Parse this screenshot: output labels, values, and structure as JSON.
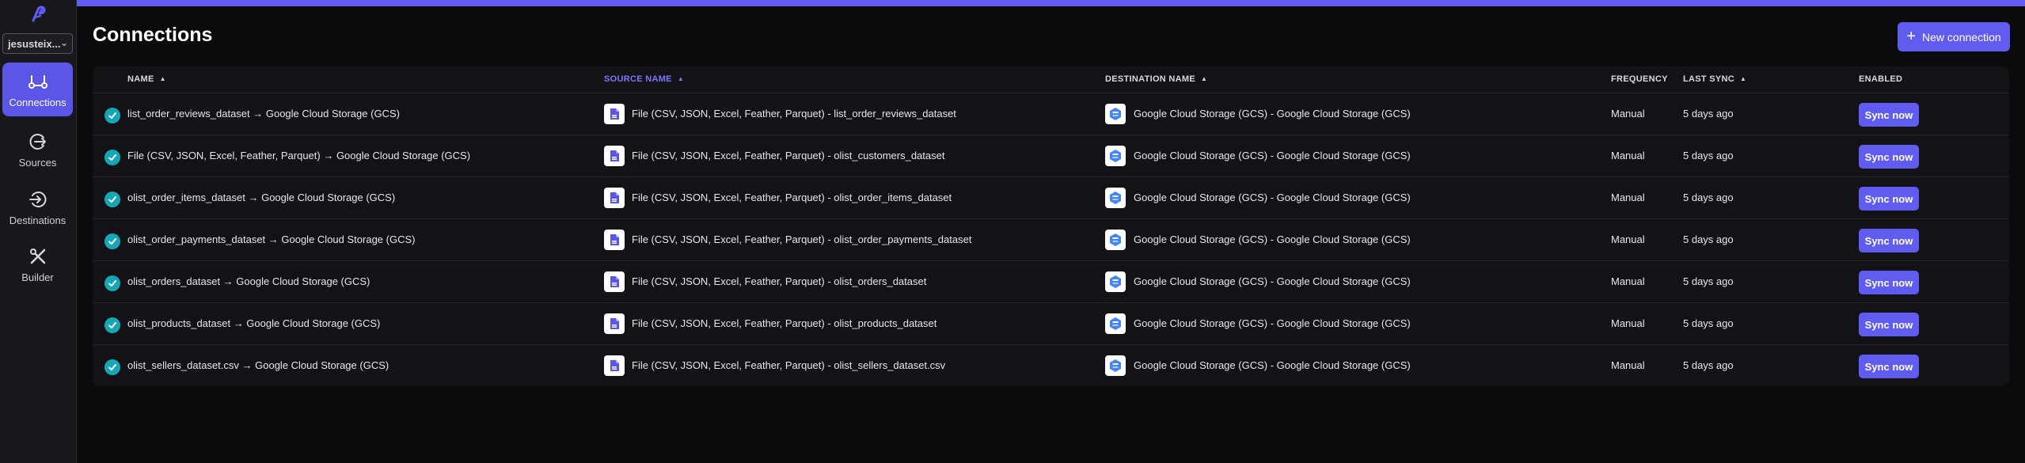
{
  "sidebar": {
    "workspace": "jesusteix...",
    "items": [
      {
        "label": "Connections",
        "icon": "connections-icon",
        "active": true
      },
      {
        "label": "Sources",
        "icon": "sources-icon",
        "active": false
      },
      {
        "label": "Destinations",
        "icon": "destinations-icon",
        "active": false
      },
      {
        "label": "Builder",
        "icon": "builder-icon",
        "active": false
      }
    ]
  },
  "header": {
    "title": "Connections",
    "new_button_label": "New connection"
  },
  "table": {
    "columns": {
      "name": "NAME",
      "source": "SOURCE NAME",
      "destination": "DESTINATION NAME",
      "frequency": "FREQUENCY",
      "last_sync": "LAST SYNC",
      "enabled": "ENABLED"
    },
    "sync_label": "Sync now",
    "rows": [
      {
        "name": "list_order_reviews_dataset → Google Cloud Storage (GCS)",
        "source": "File (CSV, JSON, Excel, Feather, Parquet) - list_order_reviews_dataset",
        "destination": "Google Cloud Storage (GCS) - Google Cloud Storage (GCS)",
        "frequency": "Manual",
        "last_sync": "5 days ago"
      },
      {
        "name": "File (CSV, JSON, Excel, Feather, Parquet) → Google Cloud Storage (GCS)",
        "source": "File (CSV, JSON, Excel, Feather, Parquet) - olist_customers_dataset",
        "destination": "Google Cloud Storage (GCS) - Google Cloud Storage (GCS)",
        "frequency": "Manual",
        "last_sync": "5 days ago"
      },
      {
        "name": "olist_order_items_dataset → Google Cloud Storage (GCS)",
        "source": "File (CSV, JSON, Excel, Feather, Parquet) - olist_order_items_dataset",
        "destination": "Google Cloud Storage (GCS) - Google Cloud Storage (GCS)",
        "frequency": "Manual",
        "last_sync": "5 days ago"
      },
      {
        "name": "olist_order_payments_dataset → Google Cloud Storage (GCS)",
        "source": "File (CSV, JSON, Excel, Feather, Parquet) - olist_order_payments_dataset",
        "destination": "Google Cloud Storage (GCS) - Google Cloud Storage (GCS)",
        "frequency": "Manual",
        "last_sync": "5 days ago"
      },
      {
        "name": "olist_orders_dataset → Google Cloud Storage (GCS)",
        "source": "File (CSV, JSON, Excel, Feather, Parquet) - olist_orders_dataset",
        "destination": "Google Cloud Storage (GCS) - Google Cloud Storage (GCS)",
        "frequency": "Manual",
        "last_sync": "5 days ago"
      },
      {
        "name": "olist_products_dataset → Google Cloud Storage (GCS)",
        "source": "File (CSV, JSON, Excel, Feather, Parquet) - olist_products_dataset",
        "destination": "Google Cloud Storage (GCS) - Google Cloud Storage (GCS)",
        "frequency": "Manual",
        "last_sync": "5 days ago"
      },
      {
        "name": "olist_sellers_dataset.csv → Google Cloud Storage (GCS)",
        "source": "File (CSV, JSON, Excel, Feather, Parquet) - olist_sellers_dataset.csv",
        "destination": "Google Cloud Storage (GCS) - Google Cloud Storage (GCS)",
        "frequency": "Manual",
        "last_sync": "5 days ago"
      }
    ]
  },
  "colors": {
    "accent": "#615cf0",
    "status_ok": "#17a6b4",
    "background": "#0b0b0e"
  }
}
